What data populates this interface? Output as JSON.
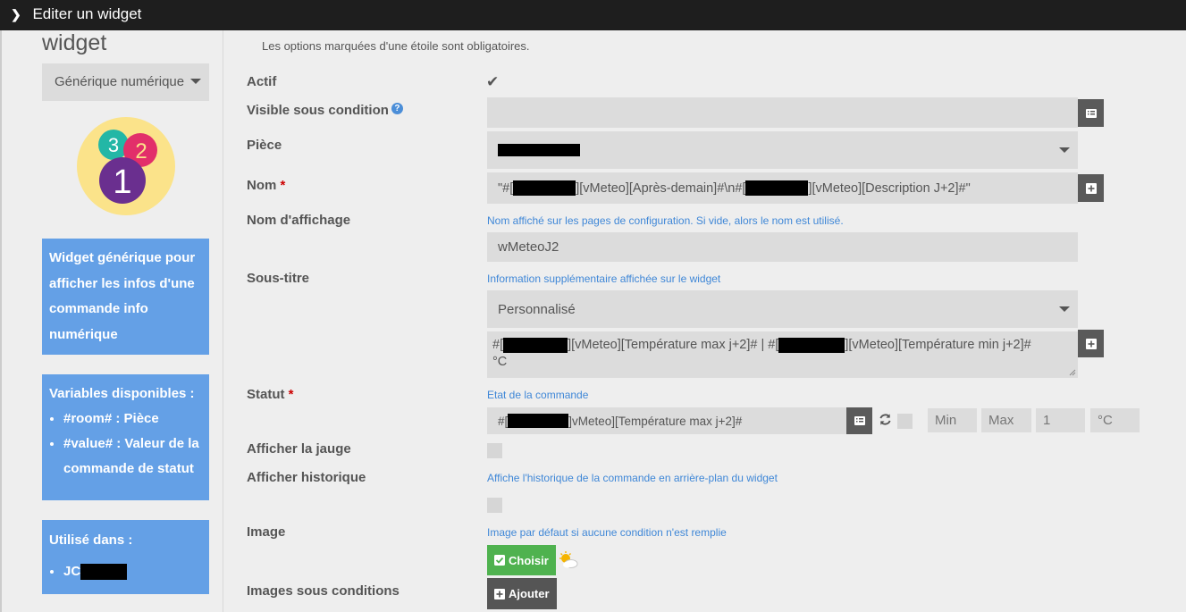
{
  "header": {
    "title": "Editer un widget"
  },
  "sidebar": {
    "title": "widget",
    "type_select": "Générique numérique",
    "description": "Widget générique pour afficher les infos d'une commande info numérique",
    "variables": {
      "title": "Variables disponibles :",
      "items": [
        {
          "code": "#room#",
          "text": " : Pièce"
        },
        {
          "code": "#value#",
          "text": " : Valeur de la commande de statut"
        }
      ]
    },
    "used_in": {
      "title": "Utilisé dans :",
      "item": "JC"
    }
  },
  "form": {
    "required_hint": "Les options marquées d'une étoile sont obligatoires.",
    "actif": {
      "label": "Actif",
      "checked": true
    },
    "visible": {
      "label": "Visible sous condition",
      "value": ""
    },
    "piece": {
      "label": "Pièce"
    },
    "nom": {
      "label": "Nom",
      "part1": "\"#[",
      "part2": "][vMeteo][Après-demain]#\\n#[",
      "part3": "][vMeteo][Description J+2]#\""
    },
    "nom_affichage": {
      "label": "Nom d'affichage",
      "info": "Nom affiché sur les pages de configuration. Si vide, alors le nom est utilisé.",
      "value": "wMeteoJ2"
    },
    "sous_titre": {
      "label": "Sous-titre",
      "info": "Information supplémentaire affichée sur le widget",
      "select": "Personnalisé",
      "text1": "#[",
      "text2": "][vMeteo][Température max j+2]# | #[",
      "text3": "][vMeteo][Température min j+2]#",
      "text4": "°C"
    },
    "statut": {
      "label": "Statut",
      "info": "Etat de la commande",
      "prefix": "#[",
      "suffix": "]vMeteo][Température max j+2]#",
      "min": "Min",
      "max": "Max",
      "step": "1",
      "unit": "°C"
    },
    "jauge": {
      "label": "Afficher la jauge"
    },
    "historique": {
      "label": "Afficher historique",
      "info": "Affiche l'historique de la commande en arrière-plan du widget"
    },
    "image": {
      "label": "Image",
      "info": "Image par défaut si aucune condition n'est remplie",
      "button": "Choisir"
    },
    "images_conditions": {
      "label": "Images sous conditions",
      "button": "Ajouter"
    }
  },
  "colors": {
    "accent_blue": "#64a0e6",
    "green": "#4fb24f",
    "dark_button": "#5a5a5a",
    "required": "#cc0000"
  }
}
